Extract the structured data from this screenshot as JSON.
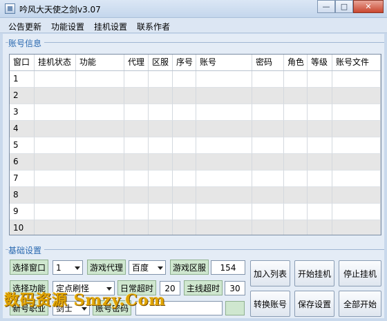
{
  "window": {
    "title": "吟风大天使之剑v3.07"
  },
  "menu": [
    "公告更新",
    "功能设置",
    "挂机设置",
    "联系作者"
  ],
  "accounts_group": {
    "title": "账号信息"
  },
  "table": {
    "columns": [
      "窗口",
      "挂机状态",
      "功能",
      "代理",
      "区服",
      "序号",
      "账号",
      "密码",
      "角色",
      "等级",
      "账号文件"
    ],
    "rows": [
      "1",
      "2",
      "3",
      "4",
      "5",
      "6",
      "7",
      "8",
      "9",
      "10"
    ]
  },
  "settings_group": {
    "title": "基础设置"
  },
  "settings": {
    "select_window_label": "选择窗口",
    "window_value": "1",
    "game_proxy_label": "游戏代理",
    "proxy_value": "百度",
    "game_server_label": "游戏区服",
    "server_value": "154",
    "select_function_label": "选择功能",
    "function_value": "定点刷怪",
    "daily_timeout_label": "日常超时",
    "daily_timeout_value": "20",
    "main_timeout_label": "主线超时",
    "main_timeout_value": "30",
    "new_class_label": "新号职业",
    "class_value": "剑士",
    "account_password_label": "账号密码",
    "account_password_value": ""
  },
  "buttons": {
    "add_to_list": "加入列表",
    "start_hook": "开始挂机",
    "stop_hook": "停止挂机",
    "switch_account": "转换账号",
    "save_settings": "保存设置",
    "start_all": "全部开始"
  },
  "watermark": "数码资源 Smzy.Com"
}
